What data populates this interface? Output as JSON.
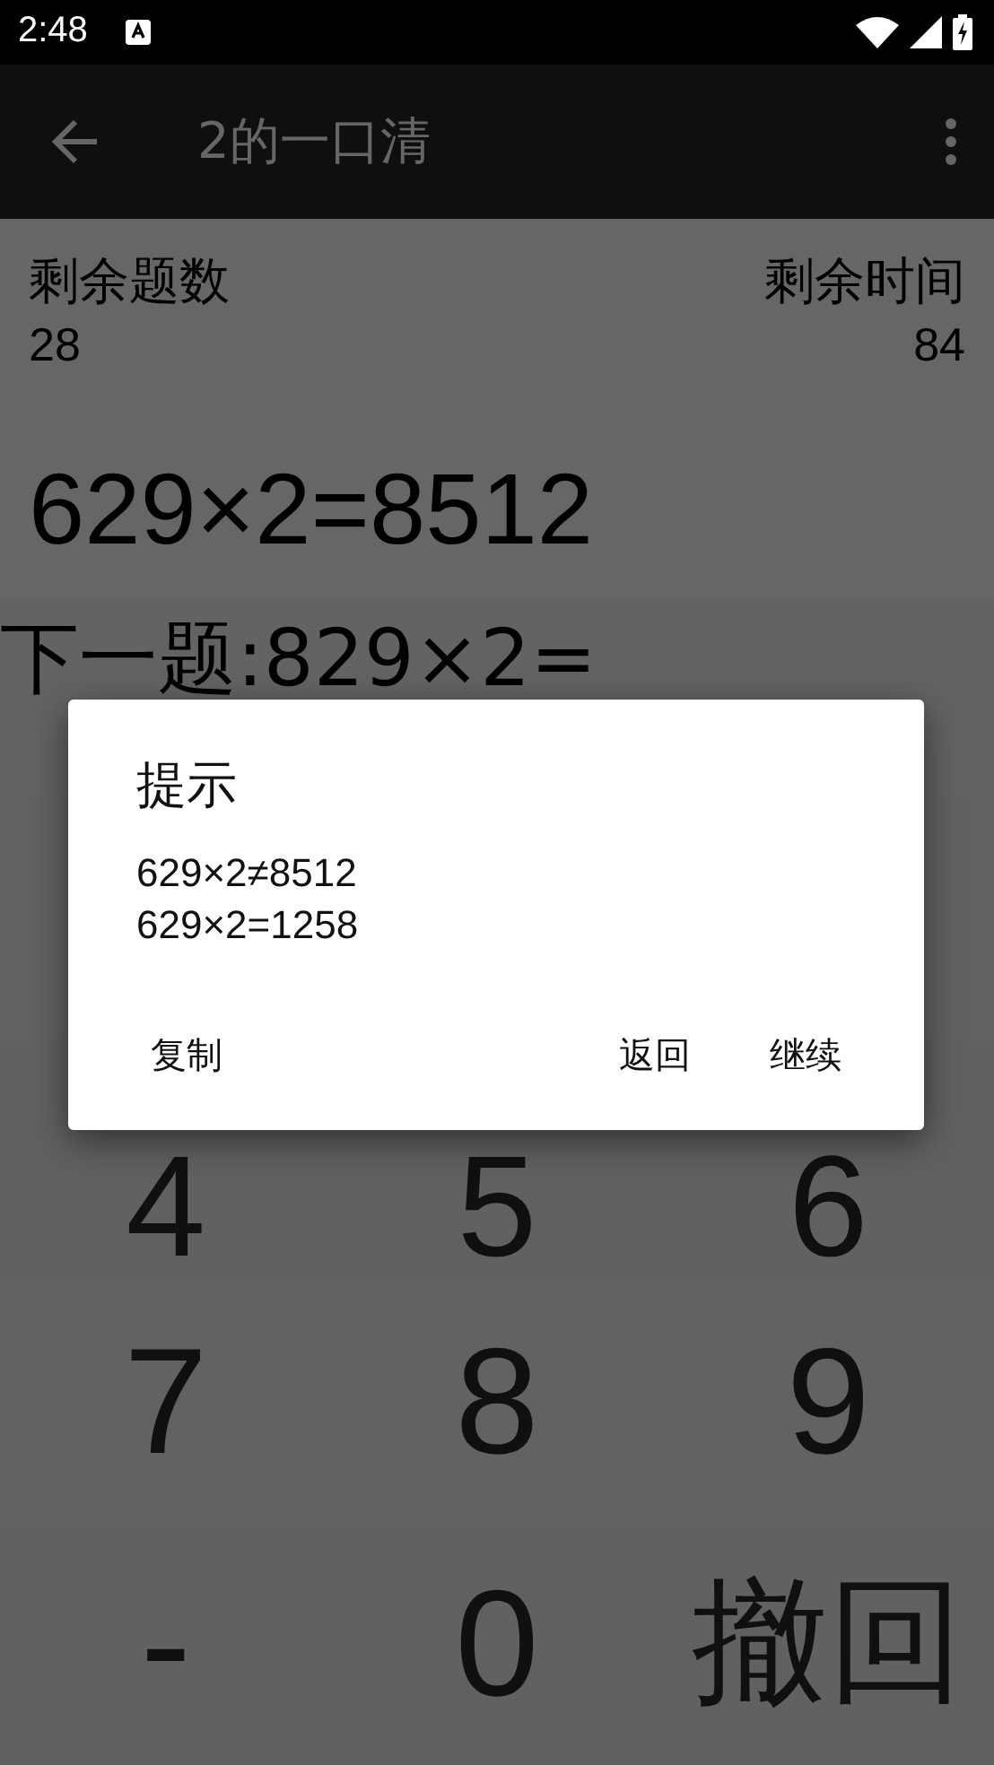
{
  "status_bar": {
    "time": "2:48"
  },
  "app_bar": {
    "title": "2的一口清"
  },
  "stats": {
    "count_label": "剩余题数",
    "count": "28",
    "time_label": "剩余时间",
    "time": "84"
  },
  "answer": "629×2=8512",
  "next_question": "下一题:829×2=",
  "keypad": [
    [
      "4",
      "5",
      "6"
    ],
    [
      "7",
      "8",
      "9"
    ],
    [
      "-",
      "0",
      "撤回"
    ]
  ],
  "dialog": {
    "title": "提示",
    "lines": [
      "629×2≠8512",
      "629×2=1258"
    ],
    "neutral_button": "复制",
    "buttons": [
      "返回",
      "继续"
    ]
  }
}
